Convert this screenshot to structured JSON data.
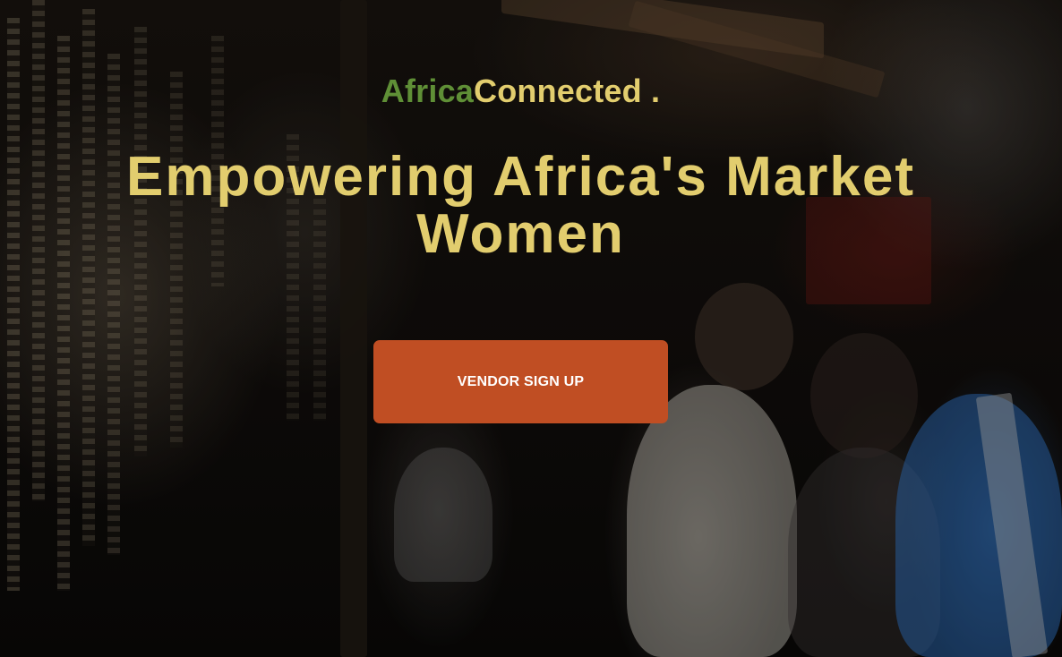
{
  "brand": {
    "part1": "Africa",
    "part2": "Connected .",
    "colors": {
      "part1": "#5f8f36",
      "part2": "#e2cd6e"
    }
  },
  "hero": {
    "headline": "Empowering Africa's Market Women",
    "headline_color": "#e2cd6e",
    "background_description_icon": "market-photo"
  },
  "cta": {
    "label": "VENDOR SIGN UP",
    "color": "#c04e23"
  }
}
